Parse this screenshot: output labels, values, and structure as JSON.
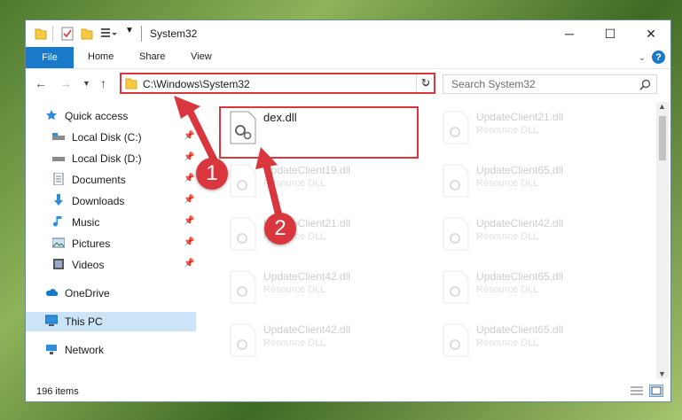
{
  "window": {
    "title": "System32"
  },
  "ribbon": {
    "file": "File",
    "home": "Home",
    "share": "Share",
    "view": "View",
    "help": "?"
  },
  "address": {
    "path": "C:\\Windows\\System32"
  },
  "search": {
    "placeholder": "Search System32"
  },
  "sidebar": {
    "items": [
      {
        "label": "Quick access",
        "icon": "star-icon"
      },
      {
        "label": "Local Disk (C:)",
        "icon": "drive-icon"
      },
      {
        "label": "Local Disk (D:)",
        "icon": "drive-icon"
      },
      {
        "label": "Documents",
        "icon": "documents-icon"
      },
      {
        "label": "Downloads",
        "icon": "downloads-icon"
      },
      {
        "label": "Music",
        "icon": "music-icon"
      },
      {
        "label": "Pictures",
        "icon": "pictures-icon"
      },
      {
        "label": "Videos",
        "icon": "videos-icon"
      },
      {
        "label": "OneDrive",
        "icon": "cloud-icon"
      },
      {
        "label": "This PC",
        "icon": "computer-icon"
      },
      {
        "label": "Network",
        "icon": "network-icon"
      }
    ]
  },
  "files": [
    {
      "name": "dex.dll",
      "type": ""
    },
    {
      "name": "UpdateClient21.dll",
      "type": "Resource DLL"
    },
    {
      "name": "UpdateClient19.dll",
      "type": "Resource DLL"
    },
    {
      "name": "UpdateClient65.dll",
      "type": "Resource DLL"
    },
    {
      "name": "UpdateClient21.dll",
      "type": "Resource DLL"
    },
    {
      "name": "UpdateClient42.dll",
      "type": "Resource DLL"
    },
    {
      "name": "UpdateClient42.dll",
      "type": "Resource DLL"
    },
    {
      "name": "UpdateClient65.dll",
      "type": "Resource DLL"
    },
    {
      "name": "UpdateClient42.dll",
      "type": "Resource DLL"
    },
    {
      "name": "UpdateClient65.dll",
      "type": "Resource DLL"
    }
  ],
  "status": {
    "count": "196 items"
  },
  "callouts": {
    "one": "1",
    "two": "2"
  },
  "colors": {
    "accent": "#1979ca",
    "highlight": "#d9363e",
    "selected": "#cce4f7"
  }
}
